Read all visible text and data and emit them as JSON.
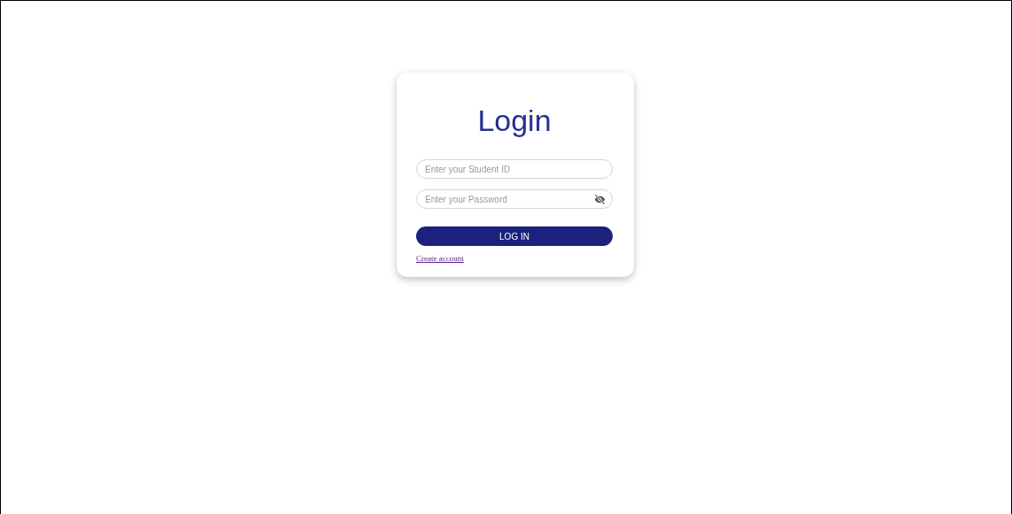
{
  "login_card": {
    "title": "Login",
    "fields": [
      {
        "placeholder": "Enter your Student ID",
        "kind": "text"
      },
      {
        "placeholder": "Enter your Password",
        "kind": "password"
      }
    ],
    "submit_button": "LOG IN",
    "create_account_link": "Create account"
  }
}
